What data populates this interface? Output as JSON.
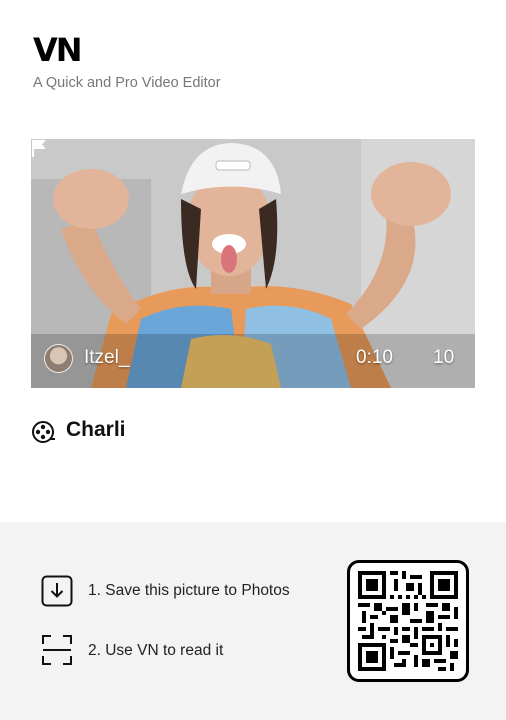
{
  "header": {
    "logo": "VN",
    "tagline": "A Quick and Pro Video Editor"
  },
  "preview": {
    "author": "Itzel_",
    "duration": "0:10",
    "clip_count": "10"
  },
  "template": {
    "name": "Charli"
  },
  "steps": [
    {
      "label": "1. Save this picture to Photos",
      "icon": "download-box-icon"
    },
    {
      "label": "2. Use VN to read it",
      "icon": "scan-frame-icon"
    }
  ],
  "qr": {
    "icon": "qr-code-icon"
  },
  "colors": {
    "background": "#ffffff",
    "panel": "#f3f3f3",
    "text": "#111111",
    "subtext": "#777777"
  }
}
